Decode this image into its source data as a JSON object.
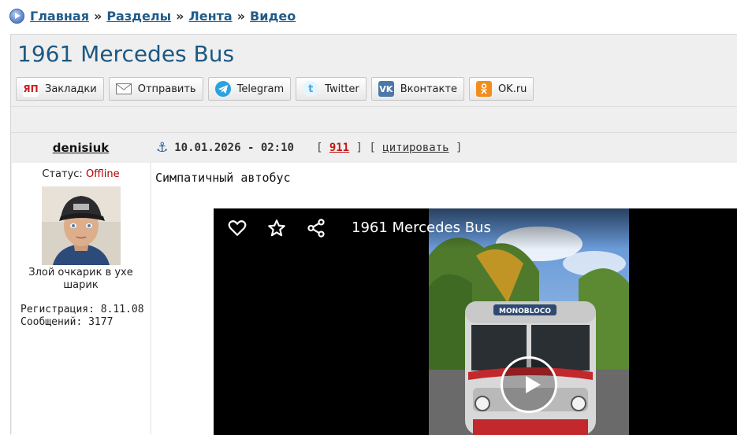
{
  "breadcrumb": {
    "items": [
      "Главная",
      "Разделы",
      "Лента",
      "Видео"
    ],
    "separator": "»"
  },
  "page": {
    "title": "1961 Mercedes Bus"
  },
  "share": {
    "buttons": [
      {
        "label": "Закладки",
        "icon": "yandex-bookmarks-icon",
        "icon_text": "ЯП"
      },
      {
        "label": "Отправить",
        "icon": "mail-icon"
      },
      {
        "label": "Telegram",
        "icon": "telegram-icon"
      },
      {
        "label": "Twitter",
        "icon": "twitter-icon"
      },
      {
        "label": "Вконтакте",
        "icon": "vk-icon",
        "icon_text": "VK"
      },
      {
        "label": "OK.ru",
        "icon": "odnoklassniki-icon"
      }
    ]
  },
  "user": {
    "name": "denisiuk",
    "status_label": "Статус:",
    "status_value": "Offline",
    "signature": "Злой очкарик в ухе шарик",
    "registration_label": "Регистрация:",
    "registration_value": "8.11.08",
    "messages_label": "Сообщений:",
    "messages_value": "3177"
  },
  "post": {
    "date": "10.01.2026 - 02:10",
    "number": "911",
    "quote_label": "цитировать",
    "text": "Симпатичный автобус"
  },
  "video": {
    "title": "1961 Mercedes Bus",
    "bus_sign": "MONOBLOCO",
    "controls": [
      "heart-icon",
      "star-icon",
      "share-icon",
      "play-icon"
    ]
  },
  "colors": {
    "link": "#1f5c8a",
    "title": "#1c5882",
    "offline": "#b20000",
    "post_number": "#c01818",
    "panel_bg": "#efefef"
  }
}
